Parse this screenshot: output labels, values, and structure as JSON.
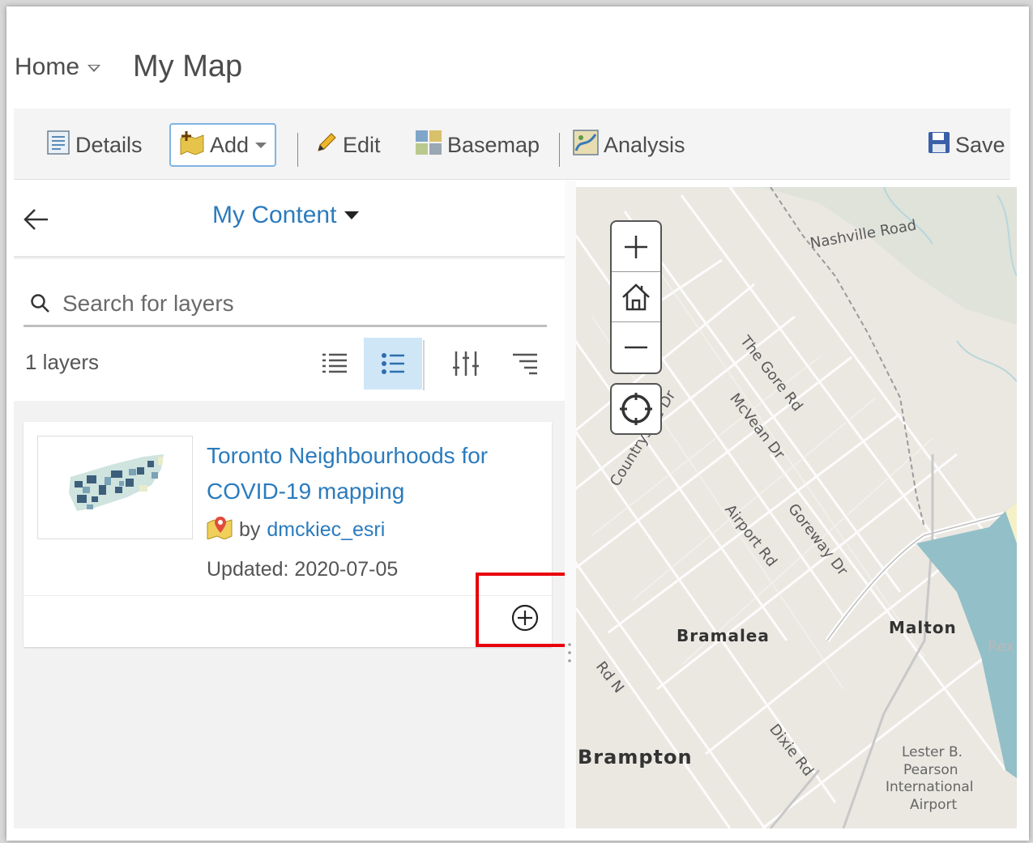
{
  "header": {
    "home_label": "Home",
    "map_title": "My Map"
  },
  "toolbar": {
    "details_label": "Details",
    "add_label": "Add",
    "edit_label": "Edit",
    "basemap_label": "Basemap",
    "analysis_label": "Analysis",
    "save_label": "Save"
  },
  "panel": {
    "content_source": "My Content",
    "search_placeholder": "Search for layers",
    "layer_count": "1 layers"
  },
  "results": [
    {
      "title": "Toronto Neighbourhoods for COVID-19 mapping",
      "by_prefix": "by",
      "owner": "dmckiec_esri",
      "updated": "Updated: 2020-07-05"
    }
  ],
  "map": {
    "places": [
      "Bramalea",
      "Brampton",
      "Malton",
      "Lester B.",
      "Pearson",
      "International",
      "Airport"
    ],
    "roads": [
      "Nashville Road",
      "The Gore Rd",
      "McVean Dr",
      "Countryside Dr",
      "Airport Rd",
      "Goreway Dr",
      "Dixie Rd",
      "Rd N",
      "Rex"
    ]
  },
  "colors": {
    "accent": "#2b7bbd",
    "highlight": "#e8000b",
    "active_view": "#cfe6f7"
  }
}
